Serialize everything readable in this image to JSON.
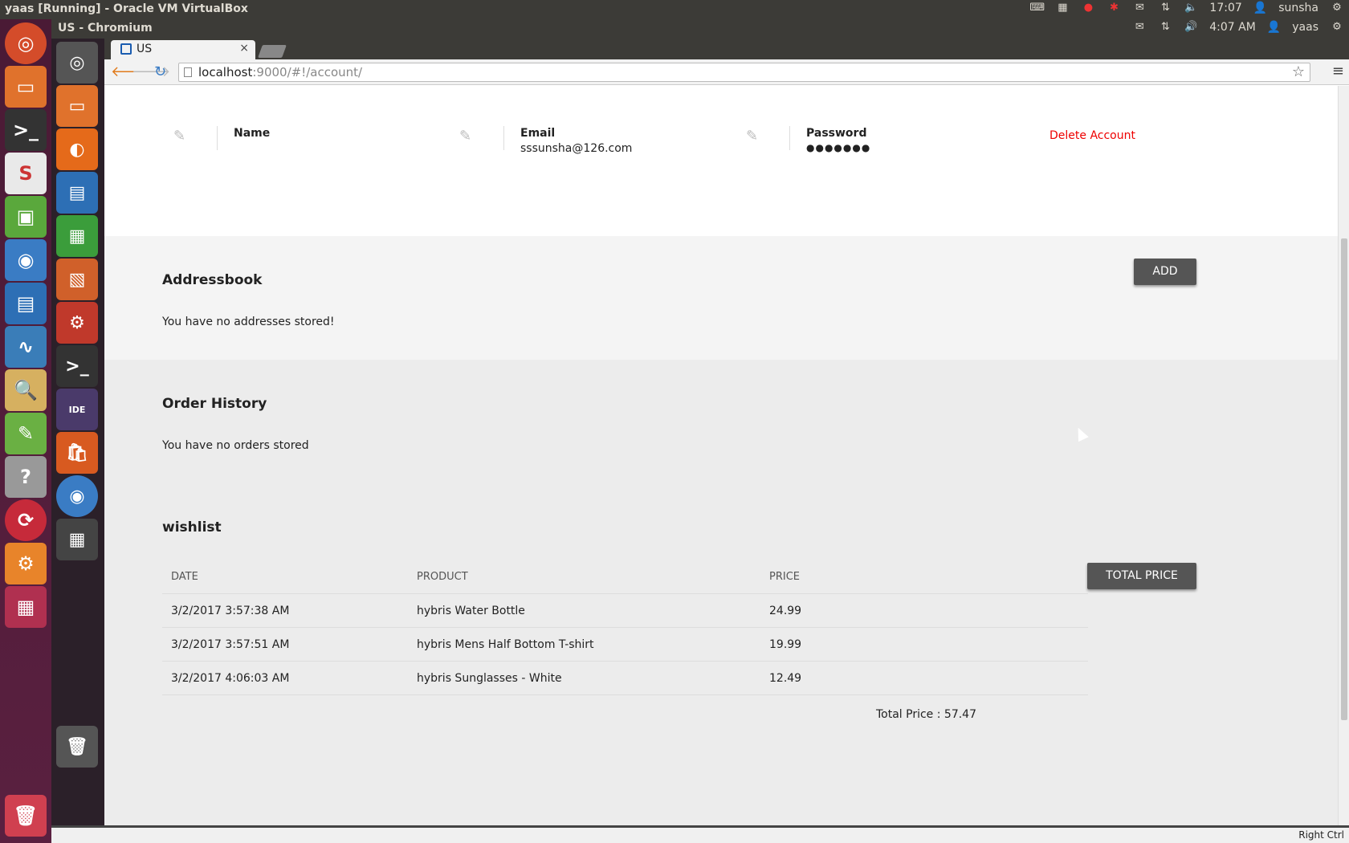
{
  "host": {
    "window_title": "yaas [Running] - Oracle VM VirtualBox",
    "time": "17:07",
    "user": "sunsha"
  },
  "guest": {
    "window_title": "US - Chromium",
    "time": "4:07 AM",
    "user": "yaas",
    "status_right": "Right Ctrl"
  },
  "browser": {
    "tab_title": "US",
    "tab_close": "×",
    "url_host": "localhost",
    "url_rest": ":9000/#!/account/"
  },
  "account": {
    "name_label": "Name",
    "name_value": "",
    "email_label": "Email",
    "email_value": "sssunsha@126.com",
    "password_label": "Password",
    "password_value": "●●●●●●●",
    "delete_label": "Delete Account"
  },
  "addressbook": {
    "title": "Addressbook",
    "add_label": "ADD",
    "empty_text": "You have no addresses stored!"
  },
  "orders": {
    "title": "Order History",
    "empty_text": "You have no orders stored"
  },
  "wishlist": {
    "title": "wishlist",
    "total_button": "TOTAL PRICE",
    "columns": [
      "DATE",
      "PRODUCT",
      "PRICE"
    ],
    "rows": [
      [
        "3/2/2017 3:57:38 AM",
        "hybris Water Bottle",
        "24.99"
      ],
      [
        "3/2/2017 3:57:51 AM",
        "hybris Mens Half Bottom T-shirt",
        "19.99"
      ],
      [
        "3/2/2017 4:06:03 AM",
        "hybris Sunglasses - White",
        "12.49"
      ]
    ],
    "total_text": "Total Price : 57.47"
  },
  "colors": {
    "delete_red": "#e00000",
    "button_gray": "#555555"
  }
}
